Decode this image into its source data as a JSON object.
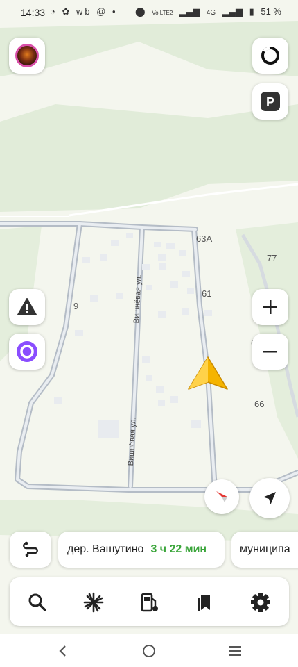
{
  "status_bar": {
    "time": "14:33",
    "notification_icons": "◔ ✿ wb @ •",
    "network": "Vo LTE2",
    "signal": "4G",
    "battery": "51 %"
  },
  "map": {
    "house_numbers": [
      "63А",
      "77",
      "61",
      "9",
      "69",
      "66"
    ],
    "streets": [
      "Вишнёвая ул.",
      "Вишнёвая ул."
    ]
  },
  "route_bar": {
    "destination": "дер. Вашутино",
    "eta": "3 ч 22 мин",
    "next_chip": "муниципа"
  },
  "toolbar": {
    "items": [
      {
        "icon": "search-icon"
      },
      {
        "icon": "discovery-icon"
      },
      {
        "icon": "fuel-icon"
      },
      {
        "icon": "bookmarks-icon"
      },
      {
        "icon": "settings-icon"
      }
    ]
  },
  "colors": {
    "accent_green": "#3aa53a",
    "arrow_yellow": "#f5b400",
    "alice_purple": "#8a4dff",
    "road_gray": "#b4bcc6"
  }
}
